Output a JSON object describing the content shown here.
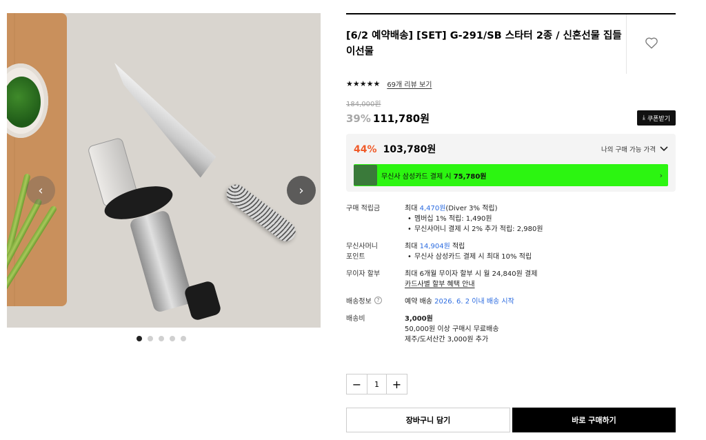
{
  "product": {
    "title": "[6/2 예약배송] [SET] G-291/SB 스타터 2종 / 신혼선물 집들이선물",
    "stars": "★★★★★",
    "review_link": "69개 리뷰 보기",
    "original_price": "184,000원",
    "discount": "39%",
    "price": "111,780원",
    "coupon_label": "쿠폰받기"
  },
  "best_price": {
    "discount": "44%",
    "price": "103,780원",
    "toggle_label": "나의 구매 가능 가격",
    "banner_text": "무신사 삼성카드 결제 시 ",
    "banner_price": "75,780원"
  },
  "details": {
    "points": {
      "label": "구매 적립금",
      "prefix": "최대 ",
      "amount": "4,470원",
      "suffix": "(Diver 3% 적립)",
      "bullets": [
        "멤버십 1% 적립: 1,490원",
        "무신사머니 결제 시 2% 추가 적립: 2,980원"
      ]
    },
    "money": {
      "label_line1": "무신사머니",
      "label_line2": "포인트",
      "prefix": "최대 ",
      "amount": "14,904원",
      "suffix": " 적립",
      "bullets": [
        "무신사 삼성카드 결제 시 최대 10% 적립"
      ]
    },
    "installment": {
      "label": "무이자 할부",
      "text": "최대 6개월 무이자 할부 시 월 24,840원 결제",
      "link": "카드사별 할부 혜택 안내"
    },
    "shipping_info": {
      "label": "배송정보",
      "text": "예약 배송 ",
      "date": "2026. 6. 2 이내 배송 시작"
    },
    "shipping_fee": {
      "label": "배송비",
      "fee": "3,000원",
      "line2": "50,000원 이상 구매시 무료배송",
      "line3": "제주/도서산간 3,000원 추가"
    }
  },
  "quantity": {
    "value": "1",
    "minus": "−",
    "plus": "+"
  },
  "actions": {
    "cart": "장바구니 담기",
    "buy": "바로 구매하기"
  },
  "gallery": {
    "slide_count": 5,
    "active_index": 0
  }
}
